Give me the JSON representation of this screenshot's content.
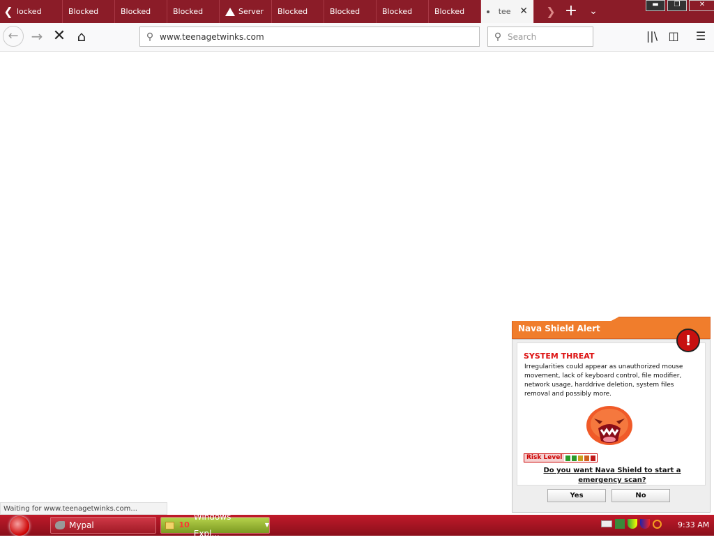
{
  "browser": {
    "tabs": [
      {
        "label": "locked",
        "state": "blocked"
      },
      {
        "label": "Blocked",
        "state": "blocked"
      },
      {
        "label": "Blocked",
        "state": "blocked"
      },
      {
        "label": "Blocked",
        "state": "blocked"
      },
      {
        "label": "Server",
        "state": "warning"
      },
      {
        "label": "Blocked",
        "state": "blocked"
      },
      {
        "label": "Blocked",
        "state": "blocked"
      },
      {
        "label": "Blocked",
        "state": "blocked"
      },
      {
        "label": "Blocked",
        "state": "blocked"
      },
      {
        "label": "tee",
        "state": "active"
      }
    ],
    "url": "www.teenagetwinks.com",
    "search_placeholder": "Search",
    "status": "Waiting for www.teenagetwinks.com..."
  },
  "popup": {
    "title": "Nava Shield Alert",
    "heading": "SYSTEM THREAT",
    "description": "Irregularities could appear as unauthorized mouse movement, lack of keyboard control, file modifier, network usage, harddrive deletion, system files removal and possibly more.",
    "risk_label": "Risk Level",
    "risk_colors": [
      "#2a9a2a",
      "#2a9a2a",
      "#c8a020",
      "#d06020",
      "#c01818"
    ],
    "question": "Do you want Nava Shield to start a emergency scan?",
    "yes_label": "Yes",
    "no_label": "No"
  },
  "taskbar": {
    "items": [
      {
        "label": "Mypal"
      },
      {
        "count": "10",
        "label": "Windows Expl..."
      }
    ],
    "time": "9:33 AM"
  },
  "colors": {
    "tabstrip": "#8b1c28",
    "taskbar": "#c01a2a",
    "popup_header": "#f07d2c"
  }
}
